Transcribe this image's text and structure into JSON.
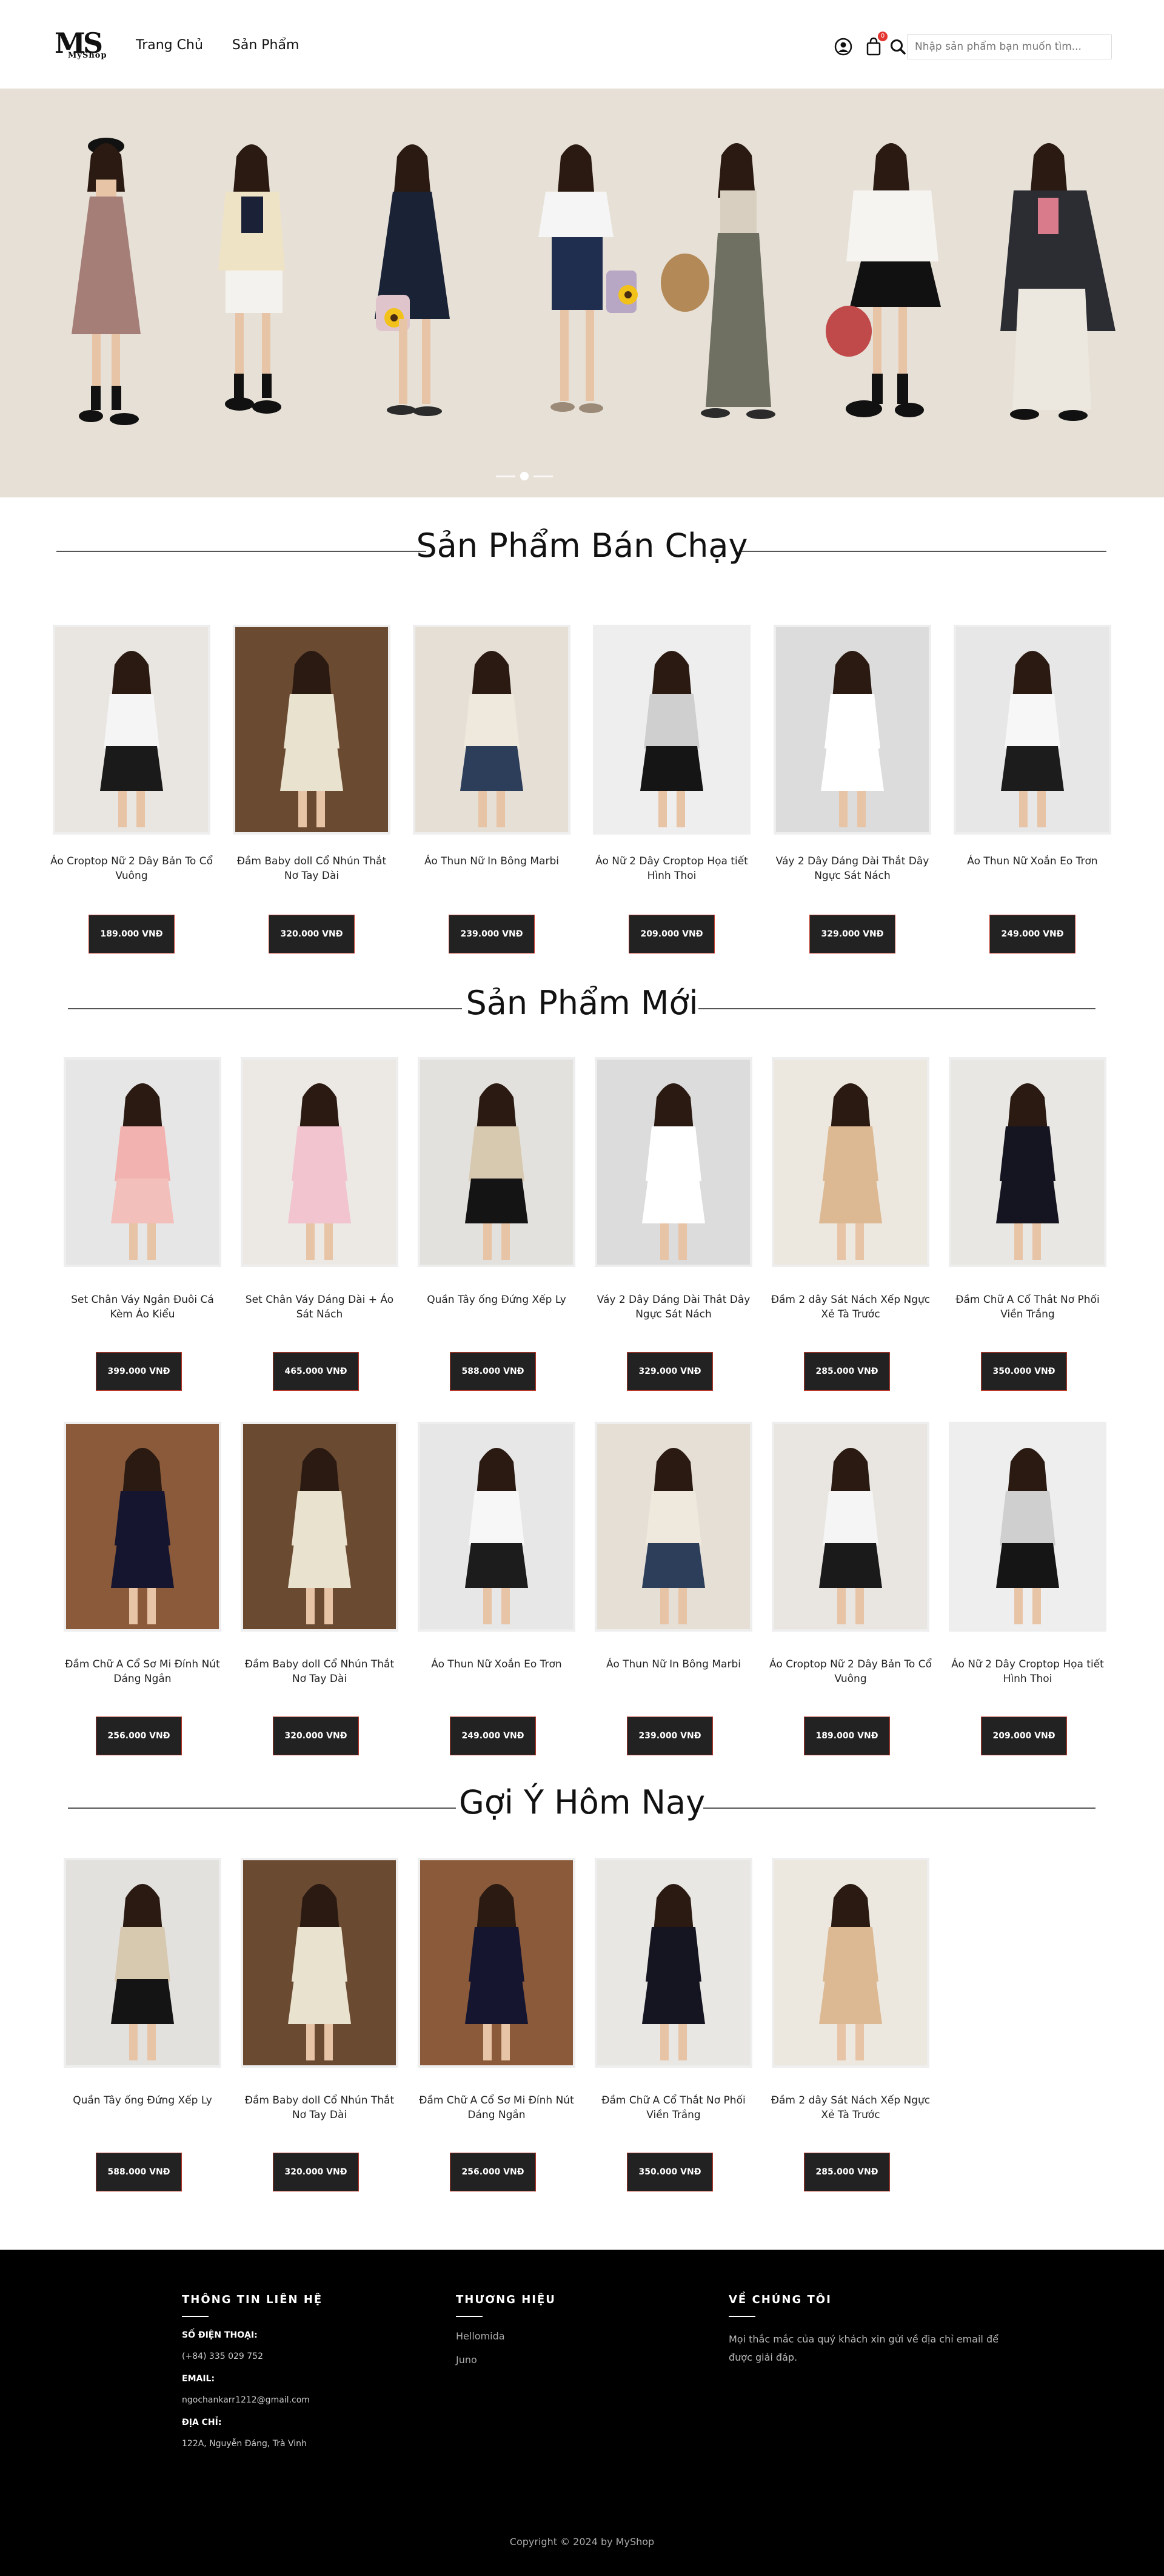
{
  "header": {
    "logo_ms": "MS",
    "logo_shop": "MyShop",
    "nav": [
      "Trang Chủ",
      "Sản Phẩm"
    ],
    "cart_count": "0",
    "search_placeholder": "Nhập sản phẩm bạn muốn tìm..."
  },
  "hero": {
    "dot_count": 3,
    "active_dot": 1
  },
  "sections": {
    "best": "Sản Phẩm Bán Chạy",
    "new": "Sản Phẩm Mới",
    "suggest": "Gợi Ý Hôm Nay"
  },
  "best_sellers": [
    {
      "name": "Áo Croptop Nữ 2 Dây Bản To Cổ Vuông",
      "price": "189.000 VNĐ",
      "bg": "#e9e6e2",
      "top": "#f5f5f5",
      "bottom": "#1a1a1a"
    },
    {
      "name": "Đầm Baby doll Cổ Nhún Thắt Nơ Tay Dài",
      "price": "320.000 VNĐ",
      "bg": "#6b4a32",
      "top": "#e9e2cf",
      "bottom": "#e9e2cf"
    },
    {
      "name": "Áo Thun Nữ In Bông Marbi",
      "price": "239.000 VNĐ",
      "bg": "#e6dfd6",
      "top": "#efe9dd",
      "bottom": "#2c3e5a"
    },
    {
      "name": "Áo Nữ 2 Dây Croptop Họa tiết Hình Thoi",
      "price": "209.000 VNĐ",
      "bg": "#eeeeee",
      "top": "#cfcfcf",
      "bottom": "#151515"
    },
    {
      "name": "Váy 2 Dây Dáng Dài Thắt Dây Ngực Sát Nách",
      "price": "329.000 VNĐ",
      "bg": "#dcdcdc",
      "top": "#ffffff",
      "bottom": "#ffffff"
    },
    {
      "name": "Áo Thun Nữ Xoắn Eo Trơn",
      "price": "249.000 VNĐ",
      "bg": "#e7e7e7",
      "top": "#f7f7f7",
      "bottom": "#1c1c1c"
    }
  ],
  "new_products": [
    {
      "name": "Set Chân Váy Ngắn Đuôi Cá Kèm Áo Kiểu",
      "price": "399.000 VNĐ",
      "bg": "#e6e6e6",
      "top": "#f2b3b0",
      "bottom": "#f3bfbb"
    },
    {
      "name": "Set Chân Váy Dáng Dài + Áo Sát Nách",
      "price": "465.000 VNĐ",
      "bg": "#ece8e4",
      "top": "#f1c4cf",
      "bottom": "#f1c4cf"
    },
    {
      "name": "Quần Tây ống Đứng Xếp Ly",
      "price": "588.000 VNĐ",
      "bg": "#e3e1dd",
      "top": "#d7c8b0",
      "bottom": "#141414"
    },
    {
      "name": "Váy 2 Dây Dáng Dài Thắt Dây Ngực Sát Nách",
      "price": "329.000 VNĐ",
      "bg": "#dcdcdc",
      "top": "#ffffff",
      "bottom": "#ffffff"
    },
    {
      "name": "Đầm 2 dây Sát Nách Xếp Ngực Xẻ Tà Trước",
      "price": "285.000 VNĐ",
      "bg": "#ede8df",
      "top": "#dcb993",
      "bottom": "#dcb993"
    },
    {
      "name": "Đầm Chữ A Cổ Thắt Nơ Phối Viền Trắng",
      "price": "350.000 VNĐ",
      "bg": "#e9e7e3",
      "top": "#151521",
      "bottom": "#151521"
    },
    {
      "name": "Đầm Chữ A Cổ Sơ Mi Đính Nút Dáng Ngắn",
      "price": "256.000 VNĐ",
      "bg": "#8a5a3a",
      "top": "#151530",
      "bottom": "#151530"
    },
    {
      "name": "Đầm Baby doll Cổ Nhún Thắt Nơ Tay Dài",
      "price": "320.000 VNĐ",
      "bg": "#6b4a32",
      "top": "#e9e2cf",
      "bottom": "#e9e2cf"
    },
    {
      "name": "Áo Thun Nữ Xoắn Eo Trơn",
      "price": "249.000 VNĐ",
      "bg": "#e7e7e7",
      "top": "#f7f7f7",
      "bottom": "#1c1c1c"
    },
    {
      "name": "Áo Thun Nữ In Bông Marbi",
      "price": "239.000 VNĐ",
      "bg": "#e6dfd6",
      "top": "#efe9dd",
      "bottom": "#2c3e5a"
    },
    {
      "name": "Áo Croptop Nữ 2 Dây Bản To Cổ Vuông",
      "price": "189.000 VNĐ",
      "bg": "#e9e6e2",
      "top": "#f5f5f5",
      "bottom": "#1a1a1a"
    },
    {
      "name": "Áo Nữ 2 Dây Croptop Họa tiết Hình Thoi",
      "price": "209.000 VNĐ",
      "bg": "#eeeeee",
      "top": "#cfcfcf",
      "bottom": "#151515"
    }
  ],
  "suggestions": [
    {
      "name": "Quần Tây ống Đứng Xếp Ly",
      "price": "588.000 VNĐ",
      "bg": "#e3e1dd",
      "top": "#d7c8b0",
      "bottom": "#141414"
    },
    {
      "name": "Đầm Baby doll Cổ Nhún Thắt Nơ Tay Dài",
      "price": "320.000 VNĐ",
      "bg": "#6b4a32",
      "top": "#e9e2cf",
      "bottom": "#e9e2cf"
    },
    {
      "name": "Đầm Chữ A Cổ Sơ Mi Đính Nút Dáng Ngắn",
      "price": "256.000 VNĐ",
      "bg": "#8a5a3a",
      "top": "#151530",
      "bottom": "#151530"
    },
    {
      "name": "Đầm Chữ A Cổ Thắt Nơ Phối Viền Trắng",
      "price": "350.000 VNĐ",
      "bg": "#e9e7e3",
      "top": "#151521",
      "bottom": "#151521"
    },
    {
      "name": "Đầm 2 dây Sát Nách Xếp Ngực Xẻ Tà Trước",
      "price": "285.000 VNĐ",
      "bg": "#ede8df",
      "top": "#dcb993",
      "bottom": "#dcb993"
    }
  ],
  "footer": {
    "contact_title": "THÔNG TIN LIÊN HỆ",
    "phone_label": "SỐ ĐIỆN THOẠI:",
    "phone": "(+84) 335 029 752",
    "email_label": "EMAIL:",
    "email": "ngochankarr1212@gmail.com",
    "address_label": "ĐỊA CHỈ:",
    "address": "122A, Nguyễn Đáng, Trà Vinh",
    "brand_title": "THƯƠNG HIỆU",
    "brands": [
      "Hellomida",
      "Juno"
    ],
    "about_title": "VỀ CHÚNG TÔI",
    "about_text": "Mọi thắc mắc của quý khách xin gửi về địa chỉ email để được giải đáp.",
    "copyright": "Copyright © 2024 by MyShop"
  },
  "colors": {
    "hero_bg": "#e7e0d6",
    "button_bg": "#222222",
    "button_border": "#c0392b",
    "footer_bg": "#000000",
    "cart_badge": "#e3342f"
  }
}
